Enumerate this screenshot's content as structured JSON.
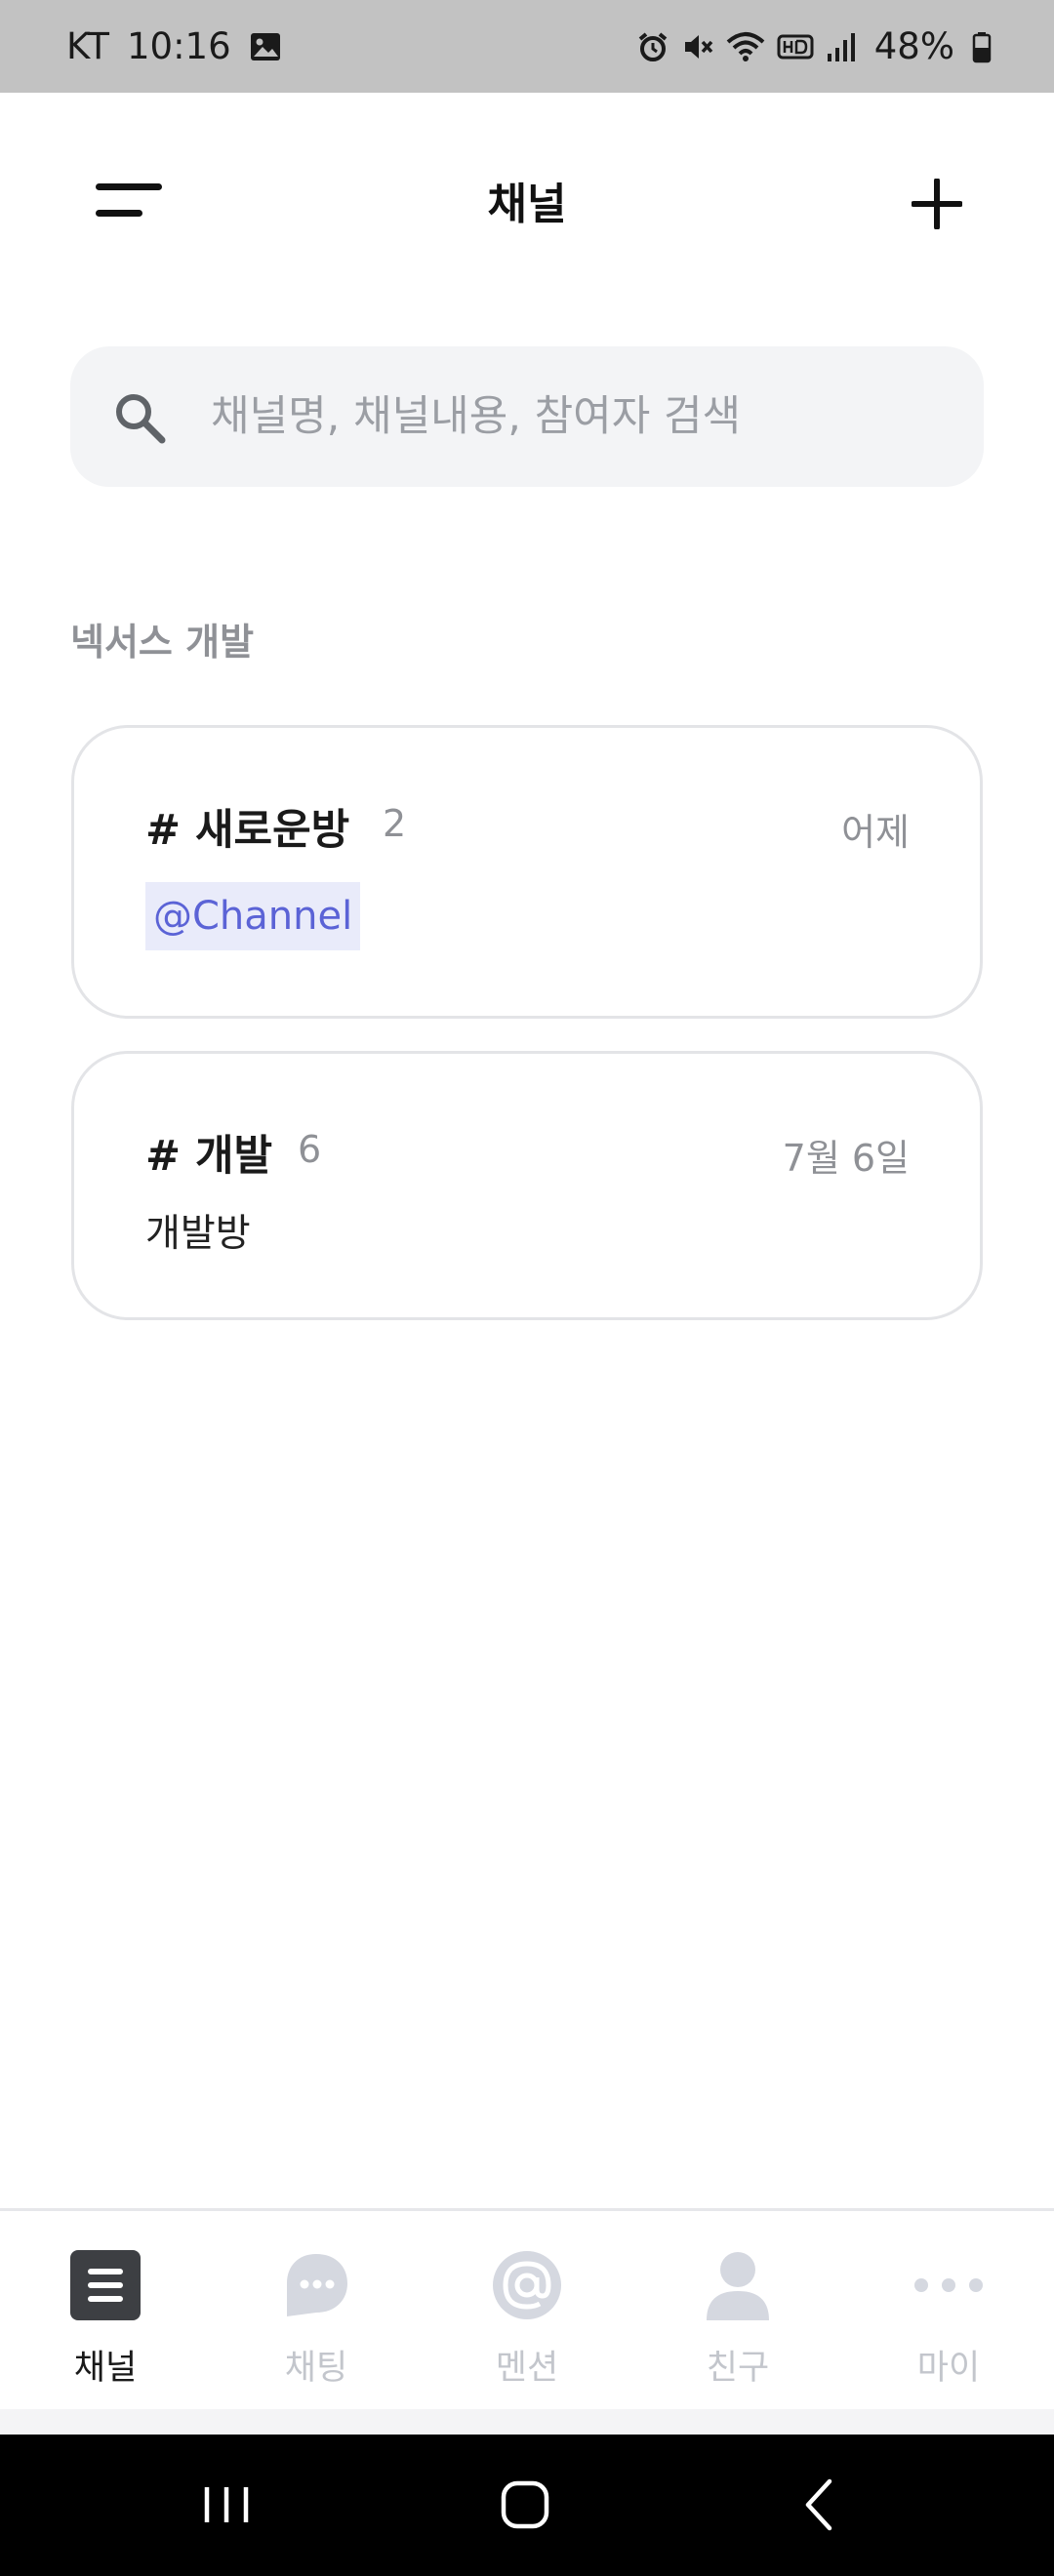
{
  "status_bar": {
    "carrier": "KT",
    "time": "10:16",
    "battery": "48%",
    "icons": [
      "image-icon",
      "alarm-icon",
      "mute-icon",
      "wifi-icon",
      "hd-icon",
      "signal-icon",
      "battery-icon"
    ]
  },
  "header": {
    "title": "채널",
    "menu_icon": "menu-icon",
    "add_icon": "plus-icon"
  },
  "search": {
    "placeholder": "채널명, 채널내용, 참여자 검색"
  },
  "section": {
    "title": "넥서스 개발"
  },
  "channels": [
    {
      "name": "# 새로운방",
      "count": "2",
      "date": "어제",
      "preview": "@Channel",
      "preview_is_mention": true
    },
    {
      "name": "# 개발",
      "count": "6",
      "date": "7월 6일",
      "preview": "개발방",
      "preview_is_mention": false
    }
  ],
  "bottom_nav": {
    "items": [
      {
        "label": "채널",
        "icon": "channel-icon",
        "active": true
      },
      {
        "label": "채팅",
        "icon": "chat-icon",
        "active": false
      },
      {
        "label": "멘션",
        "icon": "mention-icon",
        "active": false
      },
      {
        "label": "친구",
        "icon": "friend-icon",
        "active": false
      },
      {
        "label": "마이",
        "icon": "more-icon",
        "active": false
      }
    ]
  },
  "colors": {
    "status_bar_bg": "#c2c2c2",
    "search_bg": "#f3f4f6",
    "mention_text": "#5b63d6",
    "mention_bg": "#e9ebfa",
    "nav_active": "#1a1a1a",
    "nav_inactive": "#c3c6cc"
  }
}
